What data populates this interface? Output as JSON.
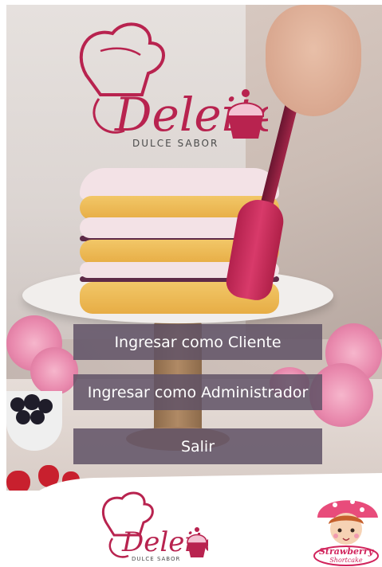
{
  "logo": {
    "brand": "Deleite",
    "tagline": "DULCE SABOR",
    "color": "#b8234f"
  },
  "menu": {
    "client_label": "Ingresar como Cliente",
    "admin_label": "Ingresar como Administrador",
    "exit_label": "Salir",
    "button_color": "#615366"
  },
  "partner_logo": {
    "line1": "Strawberry",
    "line2": "Shortcake"
  }
}
